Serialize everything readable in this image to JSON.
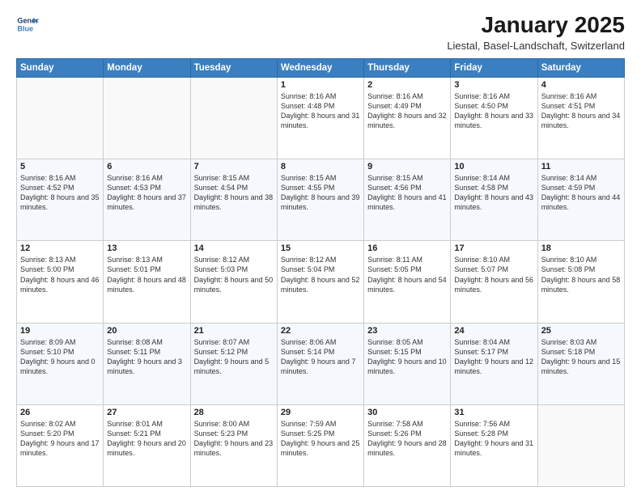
{
  "header": {
    "logo_line1": "General",
    "logo_line2": "Blue",
    "title": "January 2025",
    "subtitle": "Liestal, Basel-Landschaft, Switzerland"
  },
  "days_of_week": [
    "Sunday",
    "Monday",
    "Tuesday",
    "Wednesday",
    "Thursday",
    "Friday",
    "Saturday"
  ],
  "weeks": [
    [
      {
        "day": "",
        "info": ""
      },
      {
        "day": "",
        "info": ""
      },
      {
        "day": "",
        "info": ""
      },
      {
        "day": "1",
        "info": "Sunrise: 8:16 AM\nSunset: 4:48 PM\nDaylight: 8 hours\nand 31 minutes."
      },
      {
        "day": "2",
        "info": "Sunrise: 8:16 AM\nSunset: 4:49 PM\nDaylight: 8 hours\nand 32 minutes."
      },
      {
        "day": "3",
        "info": "Sunrise: 8:16 AM\nSunset: 4:50 PM\nDaylight: 8 hours\nand 33 minutes."
      },
      {
        "day": "4",
        "info": "Sunrise: 8:16 AM\nSunset: 4:51 PM\nDaylight: 8 hours\nand 34 minutes."
      }
    ],
    [
      {
        "day": "5",
        "info": "Sunrise: 8:16 AM\nSunset: 4:52 PM\nDaylight: 8 hours\nand 35 minutes."
      },
      {
        "day": "6",
        "info": "Sunrise: 8:16 AM\nSunset: 4:53 PM\nDaylight: 8 hours\nand 37 minutes."
      },
      {
        "day": "7",
        "info": "Sunrise: 8:15 AM\nSunset: 4:54 PM\nDaylight: 8 hours\nand 38 minutes."
      },
      {
        "day": "8",
        "info": "Sunrise: 8:15 AM\nSunset: 4:55 PM\nDaylight: 8 hours\nand 39 minutes."
      },
      {
        "day": "9",
        "info": "Sunrise: 8:15 AM\nSunset: 4:56 PM\nDaylight: 8 hours\nand 41 minutes."
      },
      {
        "day": "10",
        "info": "Sunrise: 8:14 AM\nSunset: 4:58 PM\nDaylight: 8 hours\nand 43 minutes."
      },
      {
        "day": "11",
        "info": "Sunrise: 8:14 AM\nSunset: 4:59 PM\nDaylight: 8 hours\nand 44 minutes."
      }
    ],
    [
      {
        "day": "12",
        "info": "Sunrise: 8:13 AM\nSunset: 5:00 PM\nDaylight: 8 hours\nand 46 minutes."
      },
      {
        "day": "13",
        "info": "Sunrise: 8:13 AM\nSunset: 5:01 PM\nDaylight: 8 hours\nand 48 minutes."
      },
      {
        "day": "14",
        "info": "Sunrise: 8:12 AM\nSunset: 5:03 PM\nDaylight: 8 hours\nand 50 minutes."
      },
      {
        "day": "15",
        "info": "Sunrise: 8:12 AM\nSunset: 5:04 PM\nDaylight: 8 hours\nand 52 minutes."
      },
      {
        "day": "16",
        "info": "Sunrise: 8:11 AM\nSunset: 5:05 PM\nDaylight: 8 hours\nand 54 minutes."
      },
      {
        "day": "17",
        "info": "Sunrise: 8:10 AM\nSunset: 5:07 PM\nDaylight: 8 hours\nand 56 minutes."
      },
      {
        "day": "18",
        "info": "Sunrise: 8:10 AM\nSunset: 5:08 PM\nDaylight: 8 hours\nand 58 minutes."
      }
    ],
    [
      {
        "day": "19",
        "info": "Sunrise: 8:09 AM\nSunset: 5:10 PM\nDaylight: 9 hours\nand 0 minutes."
      },
      {
        "day": "20",
        "info": "Sunrise: 8:08 AM\nSunset: 5:11 PM\nDaylight: 9 hours\nand 3 minutes."
      },
      {
        "day": "21",
        "info": "Sunrise: 8:07 AM\nSunset: 5:12 PM\nDaylight: 9 hours\nand 5 minutes."
      },
      {
        "day": "22",
        "info": "Sunrise: 8:06 AM\nSunset: 5:14 PM\nDaylight: 9 hours\nand 7 minutes."
      },
      {
        "day": "23",
        "info": "Sunrise: 8:05 AM\nSunset: 5:15 PM\nDaylight: 9 hours\nand 10 minutes."
      },
      {
        "day": "24",
        "info": "Sunrise: 8:04 AM\nSunset: 5:17 PM\nDaylight: 9 hours\nand 12 minutes."
      },
      {
        "day": "25",
        "info": "Sunrise: 8:03 AM\nSunset: 5:18 PM\nDaylight: 9 hours\nand 15 minutes."
      }
    ],
    [
      {
        "day": "26",
        "info": "Sunrise: 8:02 AM\nSunset: 5:20 PM\nDaylight: 9 hours\nand 17 minutes."
      },
      {
        "day": "27",
        "info": "Sunrise: 8:01 AM\nSunset: 5:21 PM\nDaylight: 9 hours\nand 20 minutes."
      },
      {
        "day": "28",
        "info": "Sunrise: 8:00 AM\nSunset: 5:23 PM\nDaylight: 9 hours\nand 23 minutes."
      },
      {
        "day": "29",
        "info": "Sunrise: 7:59 AM\nSunset: 5:25 PM\nDaylight: 9 hours\nand 25 minutes."
      },
      {
        "day": "30",
        "info": "Sunrise: 7:58 AM\nSunset: 5:26 PM\nDaylight: 9 hours\nand 28 minutes."
      },
      {
        "day": "31",
        "info": "Sunrise: 7:56 AM\nSunset: 5:28 PM\nDaylight: 9 hours\nand 31 minutes."
      },
      {
        "day": "",
        "info": ""
      }
    ]
  ]
}
